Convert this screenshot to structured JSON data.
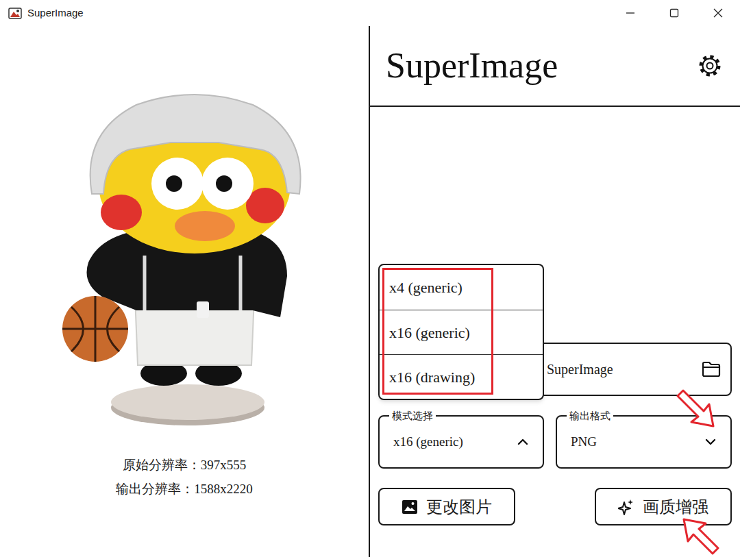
{
  "window": {
    "title": "SuperImage"
  },
  "preview": {
    "original_resolution": "原始分辨率：397x555",
    "output_resolution": "输出分辨率：1588x2220"
  },
  "header": {
    "title": "SuperImage"
  },
  "output_folder": {
    "value": "SuperImage"
  },
  "mode_select": {
    "label": "模式选择",
    "value": "x16 (generic)",
    "expanded": true,
    "options": [
      {
        "label": "x4 (generic)"
      },
      {
        "label": "x16 (generic)"
      },
      {
        "label": "x16 (drawing)"
      }
    ]
  },
  "format_select": {
    "label": "输出格式",
    "value": "PNG",
    "expanded": false
  },
  "buttons": [
    {
      "label": "更改图片"
    },
    {
      "label": "画质增强"
    }
  ]
}
